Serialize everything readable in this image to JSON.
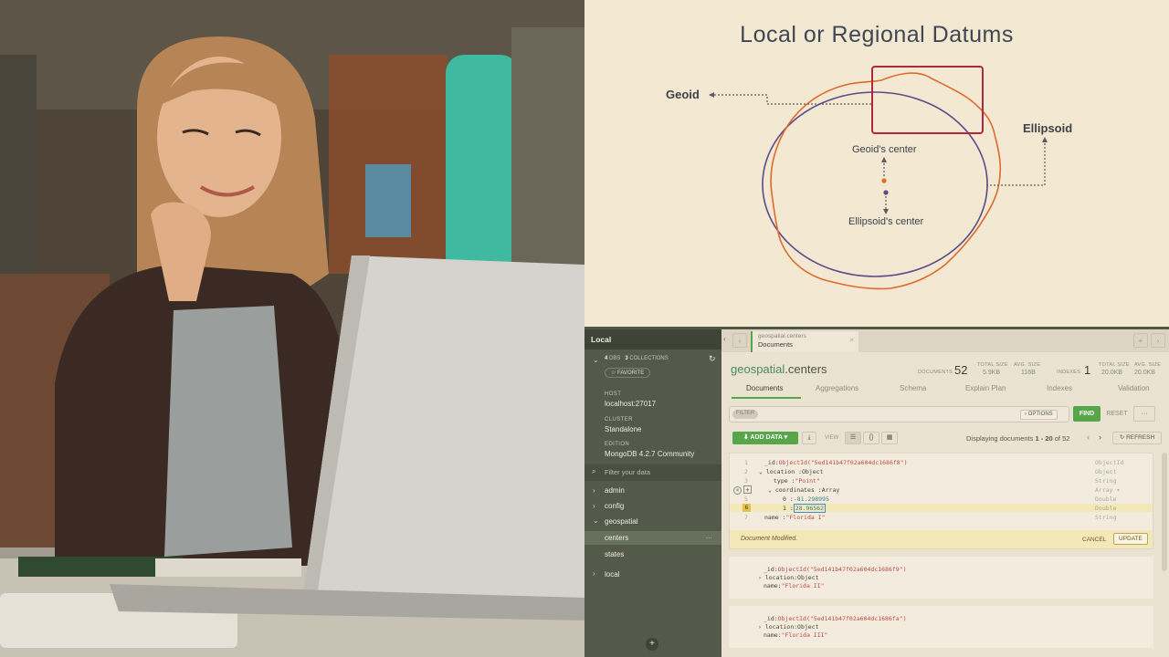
{
  "slide": {
    "title": "Local or Regional Datums",
    "geoid_label": "Geoid",
    "ellipsoid_label": "Ellipsoid",
    "geoid_center_label": "Geoid's center",
    "ellipsoid_center_label": "Ellipsoid's center",
    "colors": {
      "geoid": "#e06a2c",
      "ellipsoid": "#5a4a8a",
      "highlight": "#b0283a"
    }
  },
  "compass": {
    "sidebar": {
      "title": "Local",
      "dbs_count": "4",
      "dbs_label": "DBS",
      "collections_count": "3",
      "collections_label": "COLLECTIONS",
      "favorite_label": "☆ FAVORITE",
      "host_caption": "HOST",
      "host_value": "localhost:27017",
      "cluster_caption": "CLUSTER",
      "cluster_value": "Standalone",
      "edition_caption": "EDITION",
      "edition_value": "MongoDB 4.2.7 Community",
      "filter_placeholder": "Filter your data",
      "databases": [
        "admin",
        "config",
        "geospatial",
        "local"
      ],
      "collections": [
        "centers",
        "states"
      ],
      "more_label": "...",
      "add_label": "+"
    },
    "tab": {
      "namespace": "geospatial.centers",
      "subtitle": "Documents",
      "close": "×"
    },
    "header": {
      "db_name": "geospatial",
      "coll_name": ".centers",
      "documents_caption": "DOCUMENTS",
      "documents_value": "52",
      "total_size_caption": "TOTAL SIZE",
      "total_size_value": "5.9KB",
      "avg_size_caption": "AVG. SIZE",
      "avg_size_value": "116B",
      "indexes_caption": "INDEXES",
      "indexes_value": "1",
      "idx_total_size_value": "20.0KB",
      "idx_avg_size_value": "20.0KB"
    },
    "subtabs": [
      "Documents",
      "Aggregations",
      "Schema",
      "Explain Plan",
      "Indexes",
      "Validation"
    ],
    "query": {
      "filter_label": "FILTER",
      "options_label": "› OPTIONS",
      "find_label": "FIND",
      "reset_label": "RESET",
      "more_label": "···"
    },
    "toolbar": {
      "add_data_label": "ADD DATA ▾",
      "view_label": "VIEW",
      "displaying_label": "Displaying documents",
      "range_start": "1",
      "range_sep": "- 20",
      "range_of": "of 52",
      "refresh_label": "REFRESH"
    },
    "documents": [
      {
        "id": "ObjectId(\"5ed141b47f02a604dc1686f8\")",
        "location_type": "Object",
        "type_value": "\"Point\"",
        "coordinates_type": "Array",
        "coord0": "-81.298995",
        "coord1": "28.96562",
        "name": "\"Florida I\"",
        "types": [
          "ObjectId",
          "Object",
          "String",
          "Array ▾",
          "Double",
          "Double",
          "String"
        ],
        "modified_label": "Document Modified.",
        "cancel_label": "CANCEL",
        "update_label": "UPDATE"
      },
      {
        "id": "ObjectId(\"5ed141b47f02a604dc1686f9\")",
        "location_type": "Object",
        "name": "\"Florida II\""
      },
      {
        "id": "ObjectId(\"5ed141b47f02a604dc1686fa\")",
        "location_type": "Object",
        "name": "\"Florida III\""
      }
    ]
  }
}
